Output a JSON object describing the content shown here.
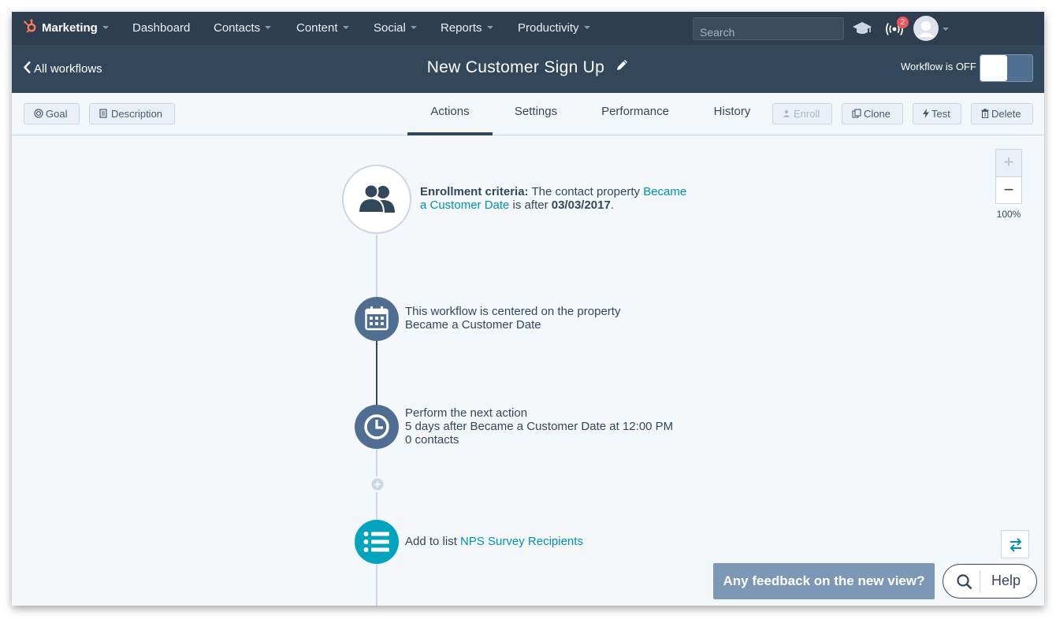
{
  "colors": {
    "nav_bg": "#2d3e50",
    "header_bg": "#33475b",
    "accent_link": "#0091ae",
    "node_dark": "#506e91",
    "node_teal": "#00a4bd",
    "feedback_bg": "#7c98b6"
  },
  "topnav": {
    "items": [
      {
        "label": "Marketing",
        "icon": "sprocket-icon",
        "has_caret": true
      },
      {
        "label": "Dashboard",
        "has_caret": false
      },
      {
        "label": "Contacts",
        "has_caret": true
      },
      {
        "label": "Content",
        "has_caret": true
      },
      {
        "label": "Social",
        "has_caret": true
      },
      {
        "label": "Reports",
        "has_caret": true
      },
      {
        "label": "Productivity",
        "has_caret": true
      }
    ],
    "search_placeholder": "Search",
    "notification_count": "2",
    "icons": [
      "academy-cap-icon",
      "broadcast-icon",
      "avatar-icon"
    ]
  },
  "header": {
    "back_label": "All workflows",
    "title": "New Customer Sign Up",
    "status_label": "Workflow is OFF",
    "workflow_on": false
  },
  "toolbar": {
    "goal_label": "Goal",
    "description_label": "Description",
    "tabs": [
      {
        "label": "Actions",
        "active": true
      },
      {
        "label": "Settings",
        "active": false
      },
      {
        "label": "Performance",
        "active": false
      },
      {
        "label": "History",
        "active": false
      }
    ],
    "enroll_label": "Enroll",
    "clone_label": "Clone",
    "test_label": "Test",
    "delete_label": "Delete"
  },
  "workflow": {
    "enrollment": {
      "prefix": "Enrollment criteria:",
      "text_before": " The contact property ",
      "property_link_1": "Became",
      "property_link_2": "a Customer Date",
      "text_after": " is after ",
      "date": "03/03/2017",
      "period": "."
    },
    "centered": {
      "line1": "This workflow is centered on the property",
      "line2": "Became a Customer Date"
    },
    "delay": {
      "line1": "Perform the next action",
      "line2": "5 days after Became a Customer Date at 12:00 PM",
      "line3": "0 contacts"
    },
    "action": {
      "prefix": "Add to list ",
      "list_link": "NPS Survey Recipients"
    }
  },
  "zoom": {
    "plus": "+",
    "minus": "−",
    "level": "100%"
  },
  "feedback_label": "Any feedback on the new view?",
  "help_label": "Help"
}
